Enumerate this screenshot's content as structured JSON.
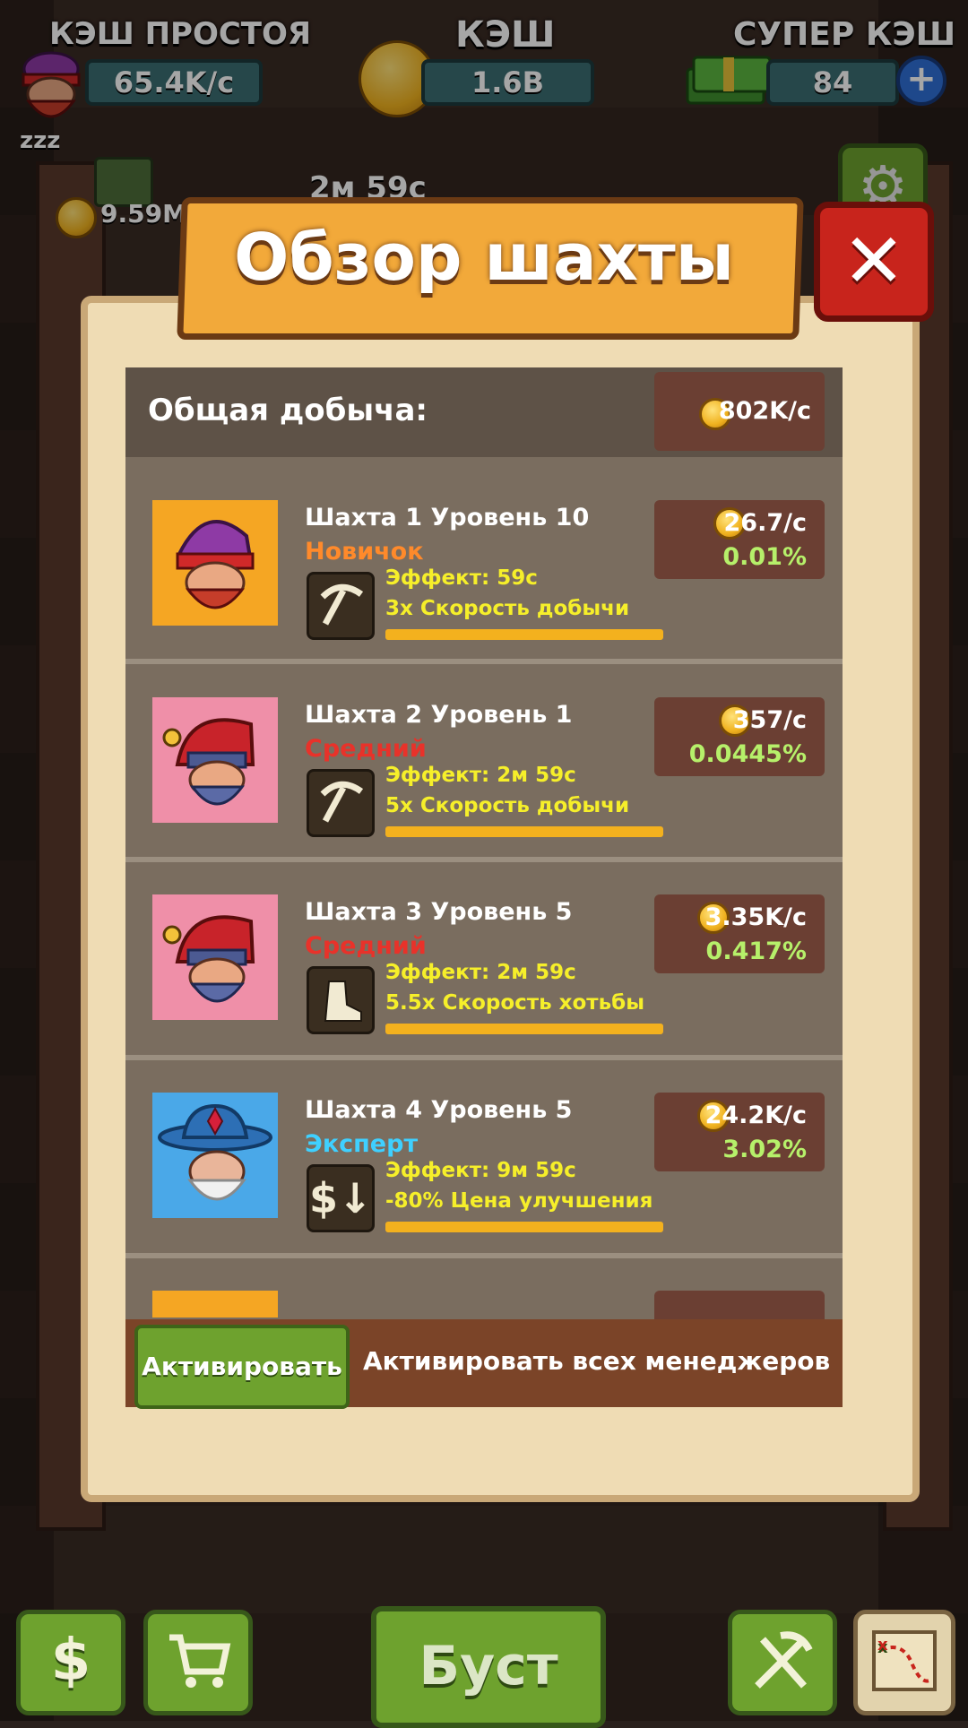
{
  "hud": {
    "idle_cash_label": "КЭШ ПРОСТОЯ",
    "idle_cash_value": "65.4K/с",
    "cash_label": "КЭШ",
    "cash_value": "1.6B",
    "super_cash_label": "СУПЕР КЭШ",
    "super_cash_value": "84",
    "plus_symbol": "+",
    "sleep_text": "zzz"
  },
  "background": {
    "side_amount": "9.59M",
    "timer": "2м 59с"
  },
  "panel": {
    "title": "Обзор шахты",
    "close_symbol": "✕",
    "total_label": "Общая добыча:",
    "total_rate": "802K/с"
  },
  "mines": [
    {
      "title": "Шахта 1 Уровень 10",
      "rank": "Новичок",
      "rank_color": "#ff8a2b",
      "effect": "Эффект: 59с",
      "description": "3x Скорость добычи",
      "rate": "26.7/с",
      "percent": "0.01%",
      "skill_icon": "pickaxe-icon",
      "manager": "purple-hat-dwarf",
      "portrait_bg": "#f5a623"
    },
    {
      "title": "Шахта 2 Уровень 1",
      "rank": "Средний",
      "rank_color": "#e8322a",
      "effect": "Эффект: 2м 59с",
      "description": "5x Скорость добычи",
      "rate": "357/с",
      "percent": "0.0445%",
      "skill_icon": "pickaxe-icon",
      "manager": "red-hood-dwarf",
      "portrait_bg": "#ef8fa8"
    },
    {
      "title": "Шахта 3 Уровень 5",
      "rank": "Средний",
      "rank_color": "#e8322a",
      "effect": "Эффект: 2м 59с",
      "description": "5.5x Скорость хотьбы",
      "rate": "3.35K/с",
      "percent": "0.417%",
      "skill_icon": "boot-icon",
      "manager": "red-hood-dwarf",
      "portrait_bg": "#ef8fa8"
    },
    {
      "title": "Шахта 4 Уровень 5",
      "rank": "Эксперт",
      "rank_color": "#3fd0ff",
      "effect": "Эффект: 9м 59с",
      "description": "-80% Цена улучшения",
      "rate": "24.2K/с",
      "percent": "3.02%",
      "skill_icon": "dollar-down-icon",
      "manager": "blue-hat-dwarf",
      "portrait_bg": "#4aa8e8"
    }
  ],
  "footer": {
    "activate_label": "Активировать",
    "activate_all_label": "Активировать всех менеджеров"
  },
  "bottom_nav": {
    "dollar_symbol": "$",
    "boost_label": "Буст"
  }
}
